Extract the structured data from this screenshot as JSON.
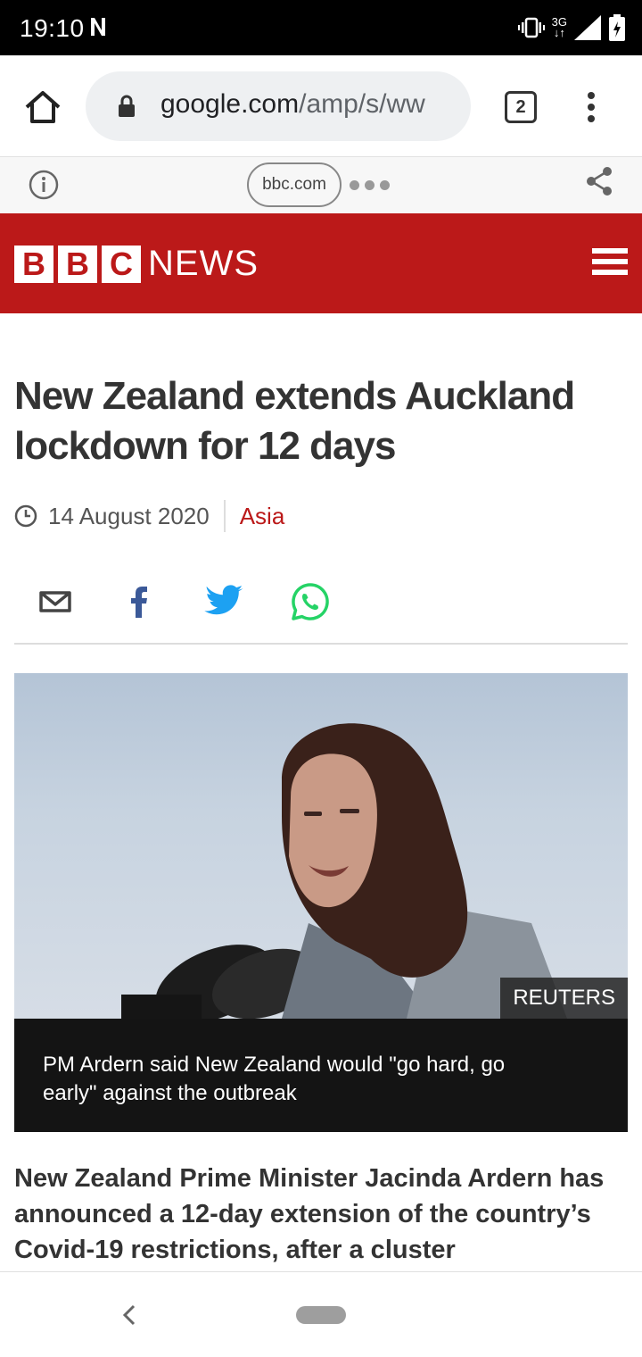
{
  "status_bar": {
    "time": "19:10",
    "network_type": "3G",
    "icons": [
      "n-icon",
      "vibrate-icon",
      "signal-icon",
      "battery-icon"
    ]
  },
  "browser": {
    "url_host": "google.com",
    "url_path": "/amp/s/ww",
    "tab_count": "2",
    "amp_domain": "bbc.com",
    "icons": [
      "home-icon",
      "lock-icon",
      "more-vert-icon",
      "info-icon",
      "share-icon"
    ]
  },
  "site_header": {
    "logo_letters": [
      "B",
      "B",
      "C"
    ],
    "brand": "NEWS",
    "brand_color": "#bb1919",
    "icons": [
      "menu-icon"
    ]
  },
  "article": {
    "headline": "New Zealand extends Auckland lockdown for 12 days",
    "date": "14 August 2020",
    "section": "Asia",
    "share_icons": [
      "email-icon",
      "facebook-icon",
      "twitter-icon",
      "whatsapp-icon"
    ],
    "image_credit": "REUTERS",
    "image_caption": "PM Ardern said New Zealand would \"go hard, go early\" against the outbreak",
    "lead_paragraph": "New Zealand Prime Minister Jacinda Ardern has announced a 12-day extension of the country’s Covid-19 restrictions, after a cluster"
  },
  "system_nav": {
    "icons": [
      "back-icon",
      "home-pill"
    ]
  }
}
